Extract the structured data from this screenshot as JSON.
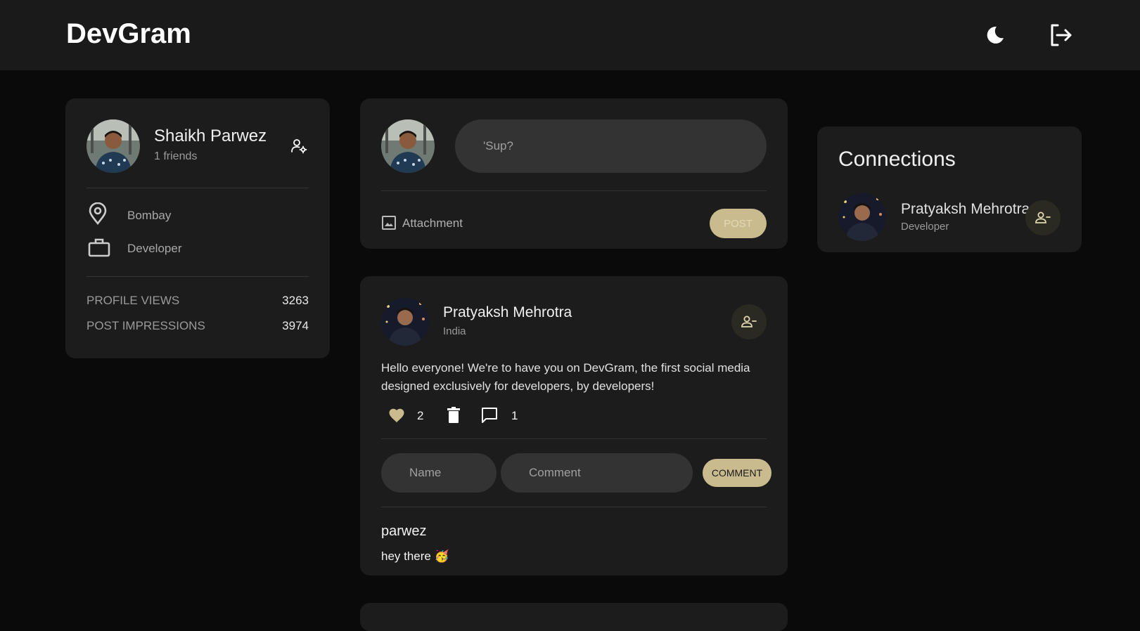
{
  "navbar": {
    "brand": "DevGram",
    "theme_icon": "moon-icon",
    "logout_icon": "logout-icon"
  },
  "profile": {
    "name": "Shaikh Parwez",
    "friends": "1 friends",
    "location": "Bombay",
    "occupation": "Developer",
    "stats": [
      {
        "label": "PROFILE VIEWS",
        "value": "3263"
      },
      {
        "label": "POST IMPRESSIONS",
        "value": "3974"
      }
    ]
  },
  "composer": {
    "placeholder": "'Sup?",
    "attachment_label": "Attachment",
    "post_button": "POST"
  },
  "post": {
    "author": "Pratyaksh Mehrotra",
    "location": "India",
    "text_line1": "Hello everyone! We're to have you on DevGram, the first social media",
    "text_line2": "designed exclusively for developers, by developers!",
    "likes": "2",
    "comments_count": "1",
    "name_placeholder": "Name",
    "comment_placeholder": "Comment",
    "comment_button": "COMMENT",
    "comment": {
      "author": "parwez",
      "text": "hey there 🥳"
    }
  },
  "connections": {
    "title": "Connections",
    "items": [
      {
        "name": "Pratyaksh Mehrotra",
        "occupation": "Developer"
      }
    ]
  },
  "colors": {
    "accent": "#c9bb8e",
    "background": "#0a0a0a",
    "card": "#1c1c1c",
    "navbar": "#1a1a1a"
  }
}
